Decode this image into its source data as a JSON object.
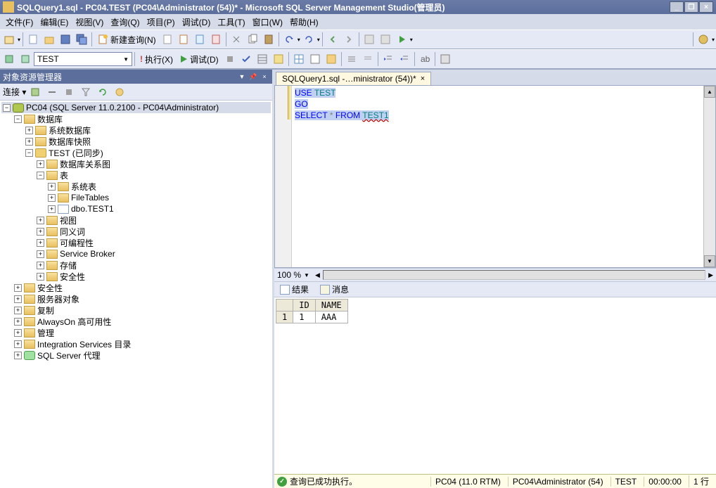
{
  "title": "SQLQuery1.sql - PC04.TEST (PC04\\Administrator (54))* - Microsoft SQL Server Management Studio(管理员)",
  "menu": [
    "文件(F)",
    "编辑(E)",
    "视图(V)",
    "查询(Q)",
    "项目(P)",
    "调试(D)",
    "工具(T)",
    "窗口(W)",
    "帮助(H)"
  ],
  "toolbar1": {
    "new_query": "新建查询(N)"
  },
  "toolbar2": {
    "db": "TEST",
    "execute": "执行(X)",
    "debug": "调试(D)"
  },
  "object_explorer": {
    "header": "对象资源管理器",
    "connect": "连接 ▾",
    "root": "PC04 (SQL Server 11.0.2100 - PC04\\Administrator)",
    "nodes": {
      "databases": "数据库",
      "sys_db": "系统数据库",
      "db_snapshot": "数据库快照",
      "test_db": "TEST (已同步)",
      "db_diagram": "数据库关系图",
      "tables": "表",
      "sys_tables": "系统表",
      "filetables": "FileTables",
      "dbo_test1": "dbo.TEST1",
      "views": "视图",
      "synonyms": "同义词",
      "programmability": "可编程性",
      "service_broker": "Service Broker",
      "storage": "存储",
      "security_db": "安全性",
      "security": "安全性",
      "server_objects": "服务器对象",
      "replication": "复制",
      "alwayson": "AlwaysOn 高可用性",
      "management": "管理",
      "integration": "Integration Services 目录",
      "sql_agent": "SQL Server 代理"
    }
  },
  "editor_tab": "SQLQuery1.sql -…ministrator (54))*",
  "sql": {
    "l1a": "USE",
    "l1b": "TEST",
    "l2": "GO",
    "l3a": "SELECT",
    "l3b": "*",
    "l3c": "FROM",
    "l3d": "TEST1"
  },
  "zoom": "100 %",
  "results_tabs": {
    "results": "结果",
    "messages": "消息"
  },
  "grid": {
    "cols": [
      "ID",
      "NAME"
    ],
    "rows": [
      {
        "n": "1",
        "ID": "1",
        "NAME": "AAA"
      }
    ]
  },
  "status": {
    "msg": "查询已成功执行。",
    "server": "PC04 (11.0 RTM)",
    "user": "PC04\\Administrator (54)",
    "db": "TEST",
    "time": "00:00:00",
    "rows": "1 行"
  }
}
